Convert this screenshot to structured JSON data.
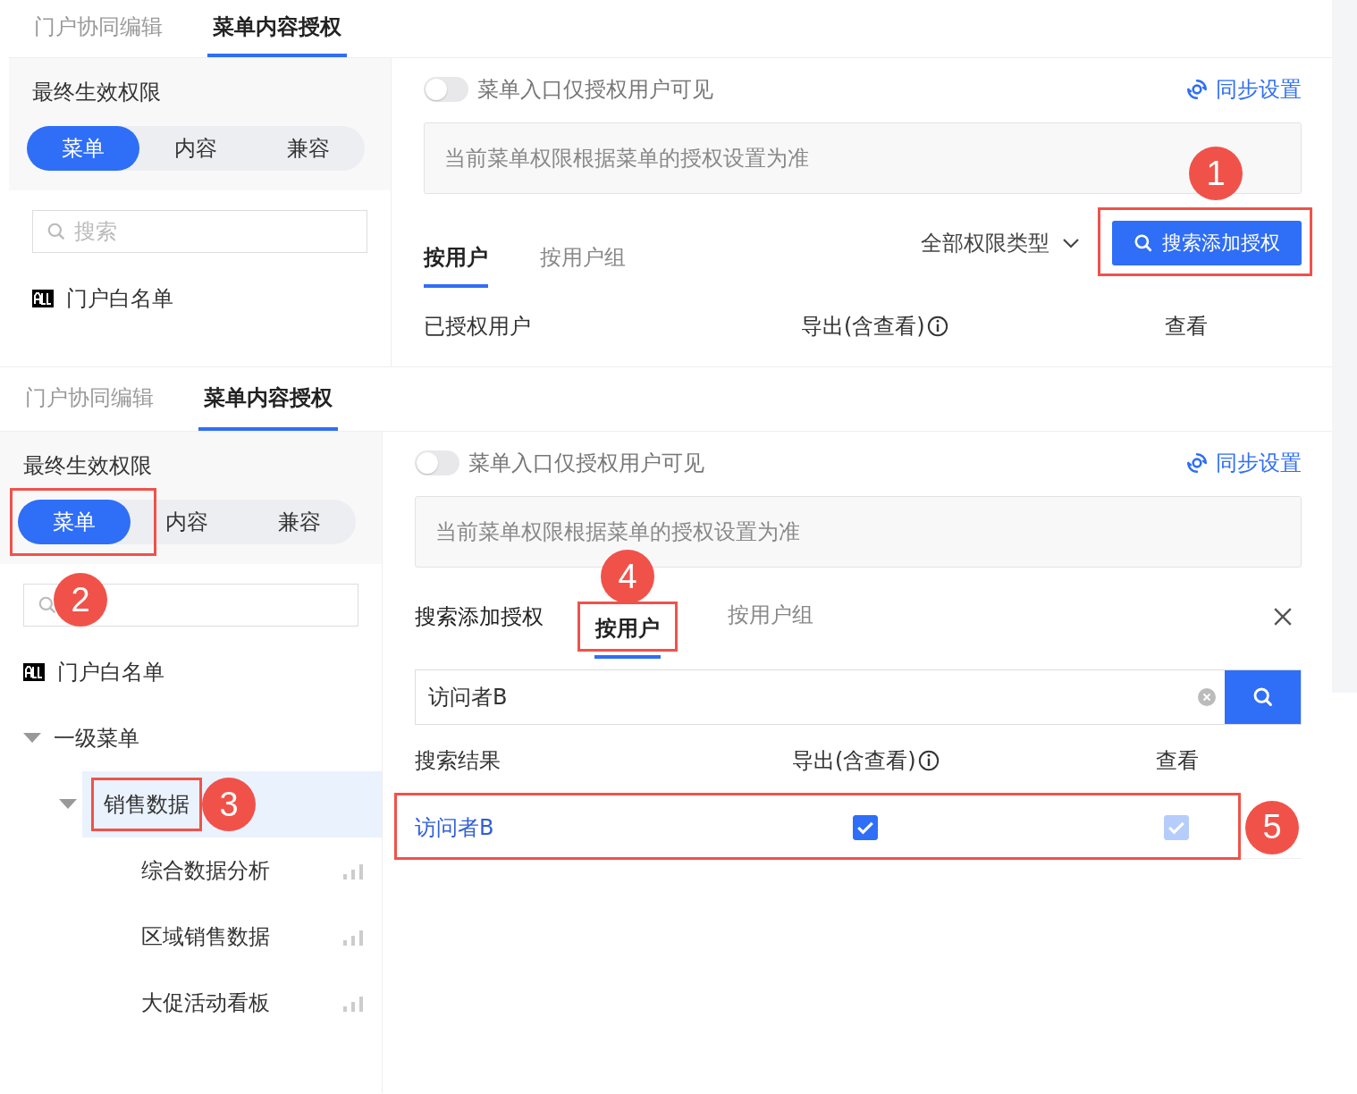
{
  "panels": [
    {
      "tabs": [
        {
          "label": "门户协同编辑",
          "selected": false
        },
        {
          "label": "菜单内容授权",
          "selected": true
        }
      ],
      "sidebar": {
        "title": "最终生效权限",
        "segments": [
          {
            "label": "菜单",
            "selected": true
          },
          {
            "label": "内容",
            "selected": false
          },
          {
            "label": "兼容",
            "selected": false
          }
        ],
        "search": {
          "placeholder": "搜索"
        },
        "tree": [
          {
            "label": "门户白名单",
            "kind": "all",
            "selected": false
          }
        ]
      },
      "main": {
        "kind": "list",
        "toggle": {
          "label": "菜单入口仅授权用户可见",
          "on": false
        },
        "sync_link": "同步设置",
        "notice": "当前菜单权限根据菜单的授权设置为准",
        "tabs": [
          {
            "label": "按用户",
            "selected": true
          },
          {
            "label": "按用户组",
            "selected": false
          }
        ],
        "filter": "全部权限类型",
        "add_button": {
          "label": "搜索添加授权",
          "callout": {
            "number": "1"
          }
        },
        "columns": [
          "已授权用户",
          "导出(含查看)",
          "查看"
        ]
      }
    },
    {
      "tabs": [
        {
          "label": "门户协同编辑",
          "selected": false
        },
        {
          "label": "菜单内容授权",
          "selected": true
        }
      ],
      "sidebar": {
        "title": "最终生效权限",
        "segments": [
          {
            "label": "菜单",
            "selected": true,
            "callout": {
              "number": "2"
            }
          },
          {
            "label": "内容",
            "selected": false
          },
          {
            "label": "兼容",
            "selected": false
          }
        ],
        "tree": [
          {
            "label": "门户白名单",
            "kind": "all",
            "selected": false
          },
          {
            "label": "一级菜单",
            "kind": "folder",
            "expanded": true,
            "selected": false,
            "children": [
              {
                "label": "销售数据",
                "kind": "folder",
                "expanded": true,
                "selected": true,
                "callout": {
                  "number": "3"
                },
                "children": [
                  {
                    "label": "综合数据分析",
                    "kind": "report",
                    "selected": false
                  },
                  {
                    "label": "区域销售数据",
                    "kind": "report",
                    "selected": false
                  },
                  {
                    "label": "大促活动看板",
                    "kind": "report",
                    "selected": false
                  }
                ]
              }
            ]
          }
        ]
      },
      "main": {
        "kind": "search",
        "toggle": {
          "label": "菜单入口仅授权用户可见",
          "on": false
        },
        "sync_link": "同步设置",
        "notice": "当前菜单权限根据菜单的授权设置为准",
        "title": "搜索添加授权",
        "tabs": [
          {
            "label": "按用户",
            "selected": true,
            "callout": {
              "number": "4"
            }
          },
          {
            "label": "按用户组",
            "selected": false
          }
        ],
        "search": {
          "value": "访问者B"
        },
        "columns": [
          "搜索结果",
          "导出(含查看)",
          "查看"
        ],
        "rows": [
          {
            "name": "访问者B",
            "export_checked": true,
            "view_checked": true,
            "view_disabled": true,
            "callout": {
              "number": "5"
            }
          }
        ]
      }
    }
  ]
}
